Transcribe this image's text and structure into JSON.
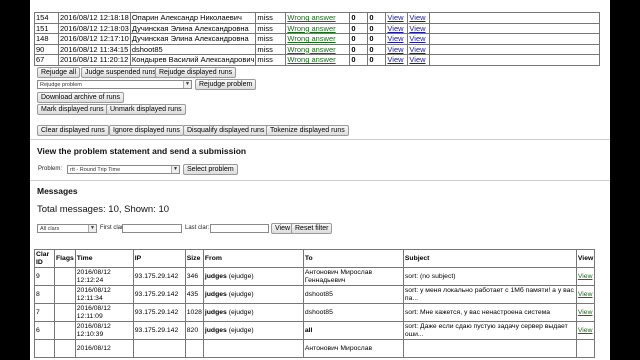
{
  "runs": [
    {
      "id": "154",
      "time": "2016/08/12 12:18:18",
      "user": "Опарин Александр Николаевич",
      "lang": "miss",
      "result": "Wrong answer",
      "score": "0",
      "col7": "0",
      "view1": "View",
      "view2": "View"
    },
    {
      "id": "151",
      "time": "2016/08/12 12:18:03",
      "user": "Дучинская Элина Александровна",
      "lang": "miss",
      "result": "Wrong answer",
      "score": "0",
      "col7": "0",
      "view1": "View",
      "view2": "View"
    },
    {
      "id": "148",
      "time": "2016/08/12 12:17:10",
      "user": "Дучинская Элина Александровна",
      "lang": "miss",
      "result": "Wrong answer",
      "score": "0",
      "col7": "0",
      "view1": "View",
      "view2": "View"
    },
    {
      "id": "90",
      "time": "2016/08/12 11:34:15",
      "user": "dshoot85",
      "lang": "miss",
      "result": "Wrong answer",
      "score": "0",
      "col7": "0",
      "view1": "View",
      "view2": "View"
    },
    {
      "id": "67",
      "time": "2016/08/12 11:20:12",
      "user": "Кондырев Василий Александрович",
      "lang": "miss",
      "result": "Wrong answer",
      "score": "0",
      "col7": "0",
      "view1": "View",
      "view2": "View"
    }
  ],
  "buttons": {
    "rejudge_all": "Rejudge all",
    "judge_suspended": "Judge suspended runs",
    "rejudge_displayed": "Rejudge displayed runs",
    "rejudge_problem": "Rejudge problem",
    "download_archive": "Download archive of runs",
    "mark_displayed": "Mark displayed runs",
    "unmark_displayed": "Unmark displayed runs",
    "clear_displayed": "Clear displayed runs",
    "ignore_displayed": "Ignore displayed runs",
    "disqualify_displayed": "Disqualify displayed runs",
    "tokenize_displayed": "Tokenize displayed runs",
    "select_problem": "Select problem",
    "view": "View",
    "reset_filter": "Reset filter"
  },
  "rejudge_select": "Rejudge problem",
  "submission": {
    "heading": "View the problem statement and send a submission",
    "problem_label": "Problem:",
    "problem_value": "rtt - Round Trip Time"
  },
  "messages": {
    "heading": "Messages",
    "total": "Total messages: 10, Shown: 10",
    "filter_select": "All clars",
    "first_clar_label": "First clar:",
    "last_clar_label": "Last clar:",
    "columns": [
      "Clar ID",
      "Flags",
      "Time",
      "IP",
      "Size",
      "From",
      "To",
      "Subject",
      "View"
    ],
    "rows": [
      {
        "id": "9",
        "flags": "",
        "time": "2016/08/12 12:12:24",
        "ip": "93.175.29.142",
        "size": "346",
        "from": "judges",
        "from_extra": "(ejudge)",
        "to": "Антонович Мирослав Геннадьевич",
        "to_bold": false,
        "subject": "sort: (no subject)",
        "view": "View"
      },
      {
        "id": "8",
        "flags": "",
        "time": "2016/08/12 12:11:34",
        "ip": "93.175.29.142",
        "size": "435",
        "from": "judges",
        "from_extra": "(ejudge)",
        "to": "dshoot85",
        "to_bold": false,
        "subject": "sort: у меня локально работает с 1Мб памяти! а у вас па...",
        "view": "View"
      },
      {
        "id": "7",
        "flags": "",
        "time": "2016/08/12 12:11:09",
        "ip": "93.175.29.142",
        "size": "1028",
        "from": "judges",
        "from_extra": "(ejudge)",
        "to": "dshoot85",
        "to_bold": false,
        "subject": "sort: Мне кажется, у вас ненастроена система",
        "view": "View"
      },
      {
        "id": "6",
        "flags": "",
        "time": "2016/08/12 12:10:39",
        "ip": "93.175.29.142",
        "size": "820",
        "from": "judges",
        "from_extra": "(ejudge)",
        "to": "all",
        "to_bold": true,
        "subject": "sort: Даже если сдаю пустую задачу сервер выдает оши...",
        "view": "View"
      },
      {
        "id": "",
        "flags": "",
        "time": "2016/08/12",
        "ip": "",
        "size": "",
        "from": "",
        "from_extra": "",
        "to": "Антонович Мирослав",
        "to_bold": false,
        "subject": "",
        "view": ""
      }
    ]
  }
}
